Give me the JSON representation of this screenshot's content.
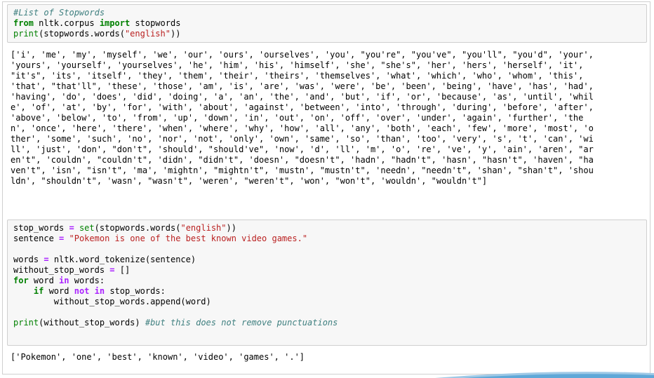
{
  "cells": [
    {
      "lines": [
        [
          {
            "t": "#List of Stopwords",
            "c": "cm"
          }
        ],
        [
          {
            "t": "from",
            "c": "kw"
          },
          {
            "t": " nltk.corpus ",
            "c": ""
          },
          {
            "t": "import",
            "c": "kw"
          },
          {
            "t": " stopwords",
            "c": ""
          }
        ],
        [
          {
            "t": "print",
            "c": "bi"
          },
          {
            "t": "(stopwords.words(",
            "c": ""
          },
          {
            "t": "\"english\"",
            "c": "st"
          },
          {
            "t": "))",
            "c": ""
          }
        ]
      ],
      "output": [
        "['i', 'me', 'my', 'myself', 'we', 'our', 'ours', 'ourselves', 'you', \"you're\", \"you've\", \"you'll\", \"you'd\", 'your',",
        "'yours', 'yourself', 'yourselves', 'he', 'him', 'his', 'himself', 'she', \"she's\", 'her', 'hers', 'herself', 'it',",
        "\"it's\", 'its', 'itself', 'they', 'them', 'their', 'theirs', 'themselves', 'what', 'which', 'who', 'whom', 'this',",
        "'that', \"that'll\", 'these', 'those', 'am', 'is', 'are', 'was', 'were', 'be', 'been', 'being', 'have', 'has', 'had',",
        "'having', 'do', 'does', 'did', 'doing', 'a', 'an', 'the', 'and', 'but', 'if', 'or', 'because', 'as', 'until', 'whil",
        "e', 'of', 'at', 'by', 'for', 'with', 'about', 'against', 'between', 'into', 'through', 'during', 'before', 'after',",
        "'above', 'below', 'to', 'from', 'up', 'down', 'in', 'out', 'on', 'off', 'over', 'under', 'again', 'further', 'the",
        "n', 'once', 'here', 'there', 'when', 'where', 'why', 'how', 'all', 'any', 'both', 'each', 'few', 'more', 'most', 'o",
        "ther', 'some', 'such', 'no', 'nor', 'not', 'only', 'own', 'same', 'so', 'than', 'too', 'very', 's', 't', 'can', 'wi",
        "ll', 'just', 'don', \"don't\", 'should', \"should've\", 'now', 'd', 'll', 'm', 'o', 're', 've', 'y', 'ain', 'aren', \"ar",
        "en't\", 'couldn', \"couldn't\", 'didn', \"didn't\", 'doesn', \"doesn't\", 'hadn', \"hadn't\", 'hasn', \"hasn't\", 'haven', \"ha",
        "ven't\", 'isn', \"isn't\", 'ma', 'mightn', \"mightn't\", 'mustn', \"mustn't\", 'needn', \"needn't\", 'shan', \"shan't\", 'shou",
        "ldn', \"shouldn't\", 'wasn', \"wasn't\", 'weren', \"weren't\", 'won', \"won't\", 'wouldn', \"wouldn't\"]"
      ]
    },
    {
      "lines": [
        [
          {
            "t": "stop_words ",
            "c": ""
          },
          {
            "t": "=",
            "c": "op"
          },
          {
            "t": " ",
            "c": ""
          },
          {
            "t": "set",
            "c": "bi"
          },
          {
            "t": "(stopwords.words(",
            "c": ""
          },
          {
            "t": "\"english\"",
            "c": "st"
          },
          {
            "t": "))",
            "c": ""
          }
        ],
        [
          {
            "t": "sentence ",
            "c": ""
          },
          {
            "t": "=",
            "c": "op"
          },
          {
            "t": " ",
            "c": ""
          },
          {
            "t": "\"Pokemon is one of the best known video games.\"",
            "c": "st"
          }
        ],
        [],
        [
          {
            "t": "words ",
            "c": ""
          },
          {
            "t": "=",
            "c": "op"
          },
          {
            "t": " nltk.word_tokenize(sentence)",
            "c": ""
          }
        ],
        [
          {
            "t": "without_stop_words ",
            "c": ""
          },
          {
            "t": "=",
            "c": "op"
          },
          {
            "t": " []",
            "c": ""
          }
        ],
        [
          {
            "t": "for",
            "c": "kw"
          },
          {
            "t": " word ",
            "c": ""
          },
          {
            "t": "in",
            "c": "kn"
          },
          {
            "t": " words:",
            "c": ""
          }
        ],
        [
          {
            "t": "    ",
            "c": ""
          },
          {
            "t": "if",
            "c": "kw"
          },
          {
            "t": " word ",
            "c": ""
          },
          {
            "t": "not",
            "c": "kn"
          },
          {
            "t": " ",
            "c": ""
          },
          {
            "t": "in",
            "c": "kn"
          },
          {
            "t": " stop_words:",
            "c": ""
          }
        ],
        [
          {
            "t": "        without_stop_words.append(word)",
            "c": ""
          }
        ],
        [],
        [
          {
            "t": "print",
            "c": "bi"
          },
          {
            "t": "(without_stop_words) ",
            "c": ""
          },
          {
            "t": "#but this does not remove punctuations",
            "c": "cm"
          }
        ]
      ],
      "output": [
        "['Pokemon', 'one', 'best', 'known', 'video', 'games', '.']"
      ]
    }
  ],
  "colors": {
    "input_bg": "#f7f7f7",
    "border": "#cfcfcf",
    "comment": "#408080",
    "keyword": "#008000",
    "operator": "#aa22ff",
    "string": "#ba2121"
  }
}
